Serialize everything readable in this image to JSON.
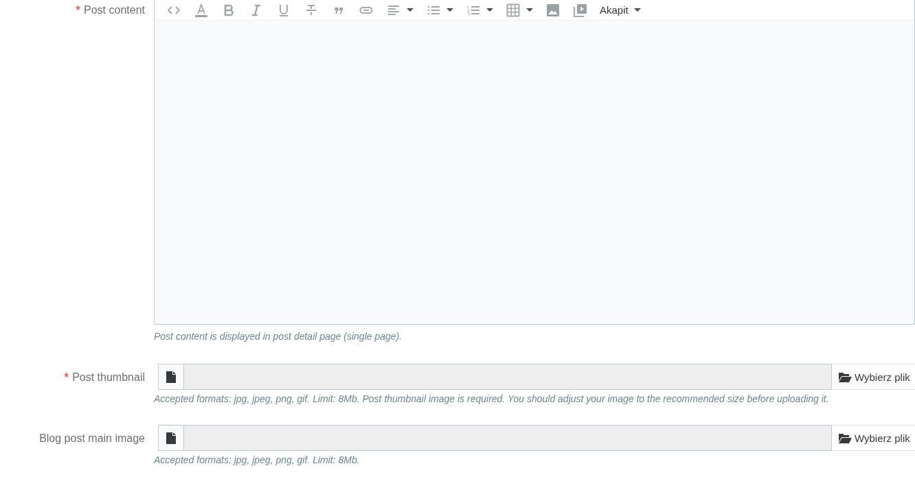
{
  "fields": [
    {
      "kind": "editor",
      "label": "Post content",
      "required_mark": "*",
      "toolbar": [
        {
          "kind": "code",
          "has_menu": false
        },
        {
          "kind": "text-color",
          "has_menu": false
        },
        {
          "kind": "bold",
          "has_menu": false
        },
        {
          "kind": "italic",
          "has_menu": false
        },
        {
          "kind": "underline",
          "has_menu": false
        },
        {
          "kind": "strike",
          "has_menu": false
        },
        {
          "kind": "quote",
          "has_menu": false
        },
        {
          "kind": "link",
          "has_menu": false
        },
        {
          "kind": "align",
          "has_menu": true
        },
        {
          "kind": "bullets",
          "has_menu": true
        },
        {
          "kind": "numbers",
          "has_menu": true
        },
        {
          "kind": "table",
          "has_menu": true
        },
        {
          "kind": "image",
          "has_menu": false
        },
        {
          "kind": "video",
          "has_menu": false
        }
      ],
      "format": "Akapit",
      "help": "Post content is displayed in post detail page (single page)."
    },
    {
      "kind": "file",
      "label": "Post thumbnail",
      "required_mark": "*",
      "button": "Wybierz plik",
      "help": "Accepted formats: jpg, jpeg, png, gif. Limit: 8Mb. Post thumbnail image is required. You should adjust your image to the recommended size before uploading it."
    },
    {
      "kind": "file",
      "label": "Blog post main image",
      "button": "Wybierz plik",
      "help": "Accepted formats: jpg, jpeg, png, gif. Limit: 8Mb."
    }
  ]
}
